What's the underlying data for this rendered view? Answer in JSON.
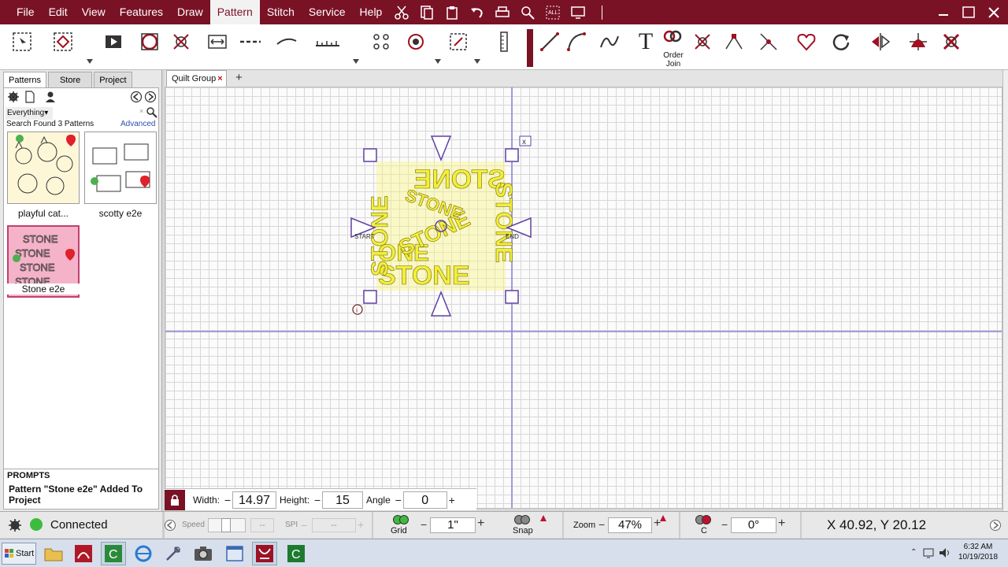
{
  "menubar": {
    "items": [
      "File",
      "Edit",
      "View",
      "Features",
      "Draw",
      "Pattern",
      "Stitch",
      "Service",
      "Help"
    ],
    "active": "Pattern",
    "accent": "#7a1226"
  },
  "toolbar": {
    "order_join_label_1": "Order",
    "order_join_label_2": "Join",
    "text_tool_label": "T"
  },
  "left_panel": {
    "tabs": [
      "Patterns",
      "Store",
      "Project"
    ],
    "filter_value": "Everything",
    "search_status": "Search Found 3 Patterns",
    "advanced_link": "Advanced",
    "patterns": [
      {
        "label": "playful cat..."
      },
      {
        "label": "scotty e2e"
      },
      {
        "label": "Stone e2e"
      }
    ],
    "prompts_title": "PROMPTS",
    "prompts_message": "Pattern \"Stone e2e\" Added To Project"
  },
  "workspace": {
    "doc_tab": "Quilt Group",
    "start_label": "START",
    "end_label": "END",
    "close_marker": "x",
    "selection_color": "#e6ef16"
  },
  "dimensions": {
    "width_label": "Width:",
    "width_value": "14.97",
    "height_label": "Height:",
    "height_value": "15",
    "angle_label": "Angle",
    "angle_value": "0"
  },
  "statusbar": {
    "connection": "Connected",
    "speed_label": "Speed",
    "speed_value": "--",
    "spi_label": "SPI",
    "spi_value": "--",
    "grid_label": "Grid",
    "grid_value": "1\"",
    "snap_label": "Snap",
    "zoom_label": "Zoom",
    "zoom_value": "47%",
    "c_label": "C",
    "rotation_value": "0°",
    "coords": "X 40.92, Y 20.12"
  },
  "taskbar": {
    "start_label": "Start",
    "time": "6:32 AM",
    "date": "10/19/2018"
  }
}
